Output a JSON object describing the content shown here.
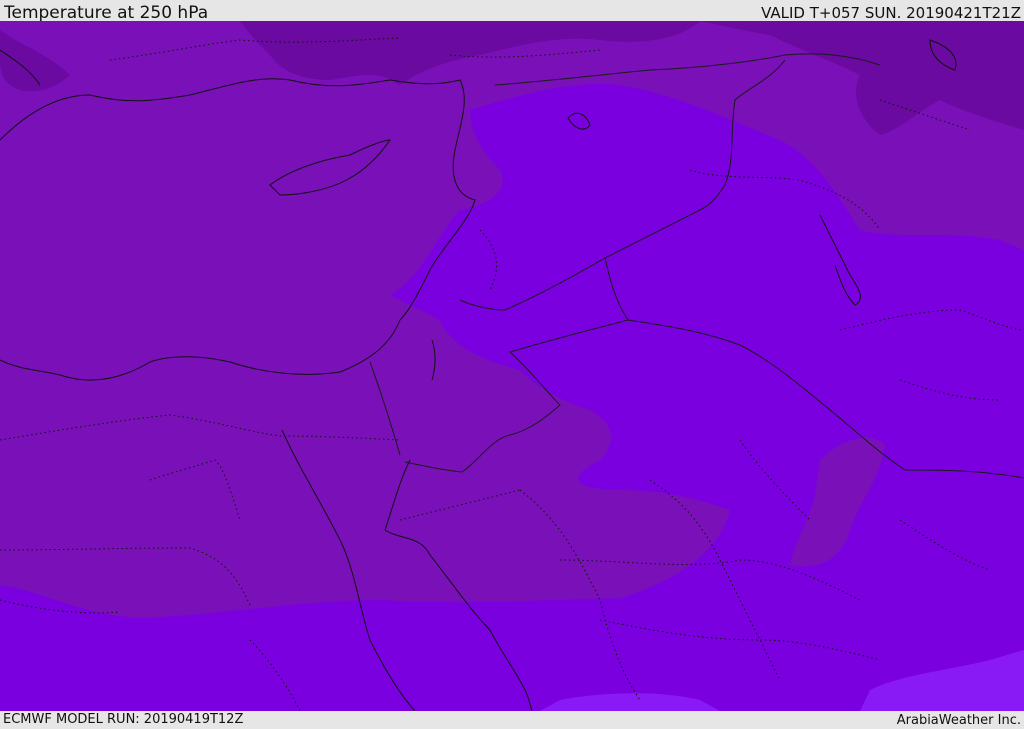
{
  "header": {
    "title": "Temperature at 250 hPa",
    "valid_time": "VALID T+057 SUN. 20190421T21Z"
  },
  "footer": {
    "model_run": "ECMWF MODEL RUN: 20190419T12Z",
    "credit": "ArabiaWeather Inc."
  },
  "map": {
    "colors": {
      "base_field": "#7a10b8",
      "warm_field": "#7b00e0",
      "warmer_field": "#8a1af5",
      "cold_field": "#6a0aa0",
      "coline": "#111111",
      "border_line": "#1a1a1a"
    }
  }
}
